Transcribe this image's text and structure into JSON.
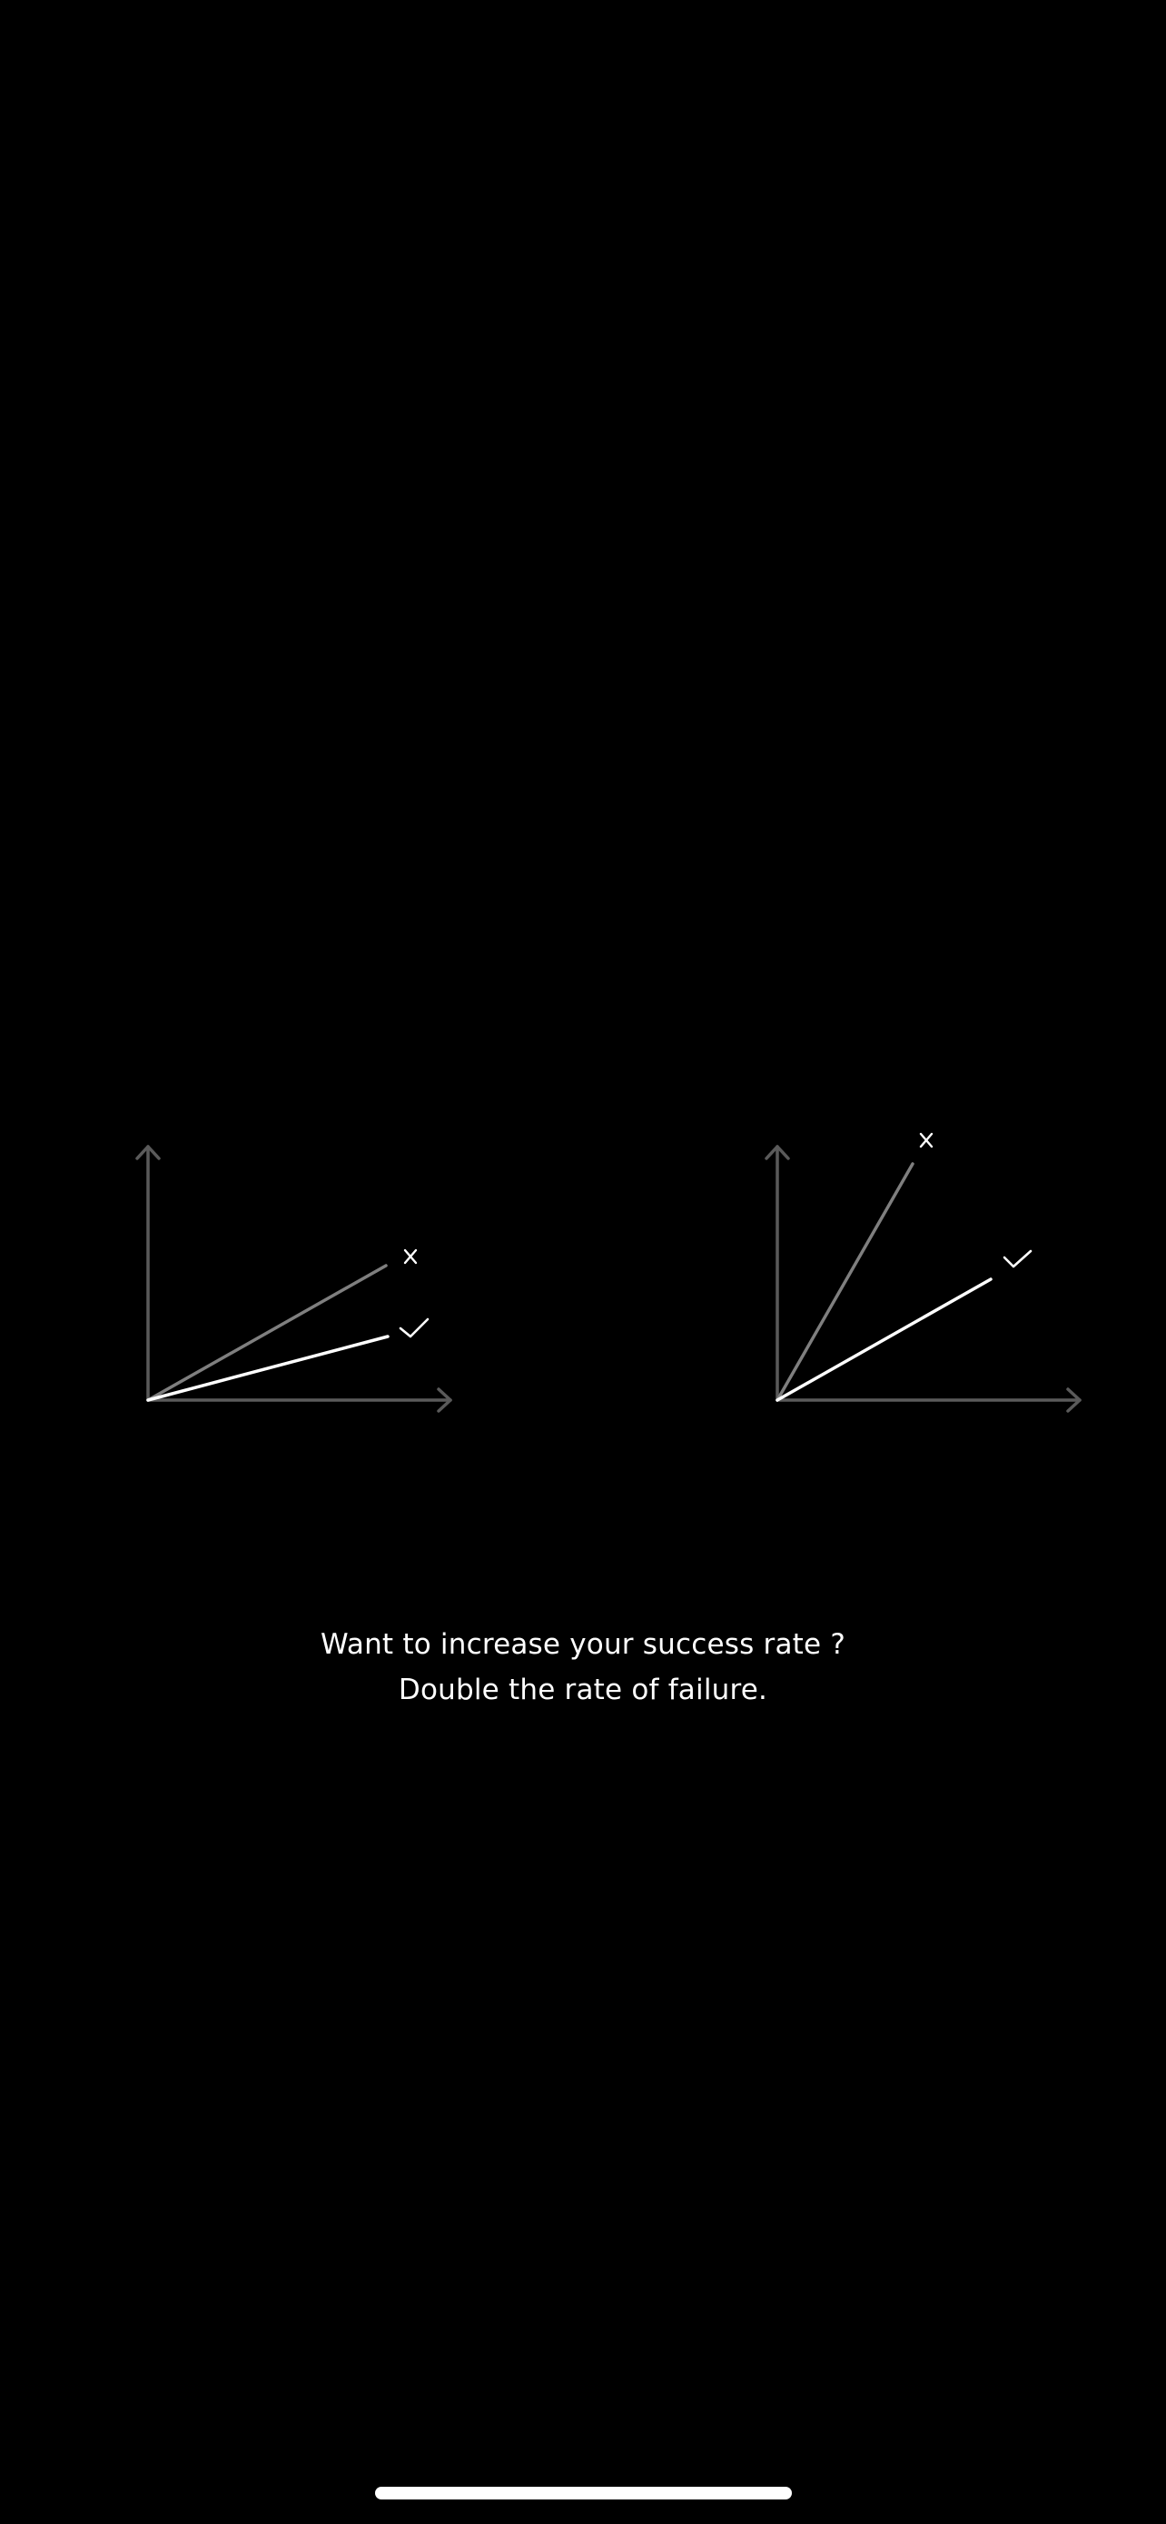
{
  "caption": {
    "line1": "Want to increase your success rate ?",
    "line2": "Double the rate of failure."
  },
  "diagrams": [
    {
      "name": "left",
      "lines": [
        {
          "kind": "failure",
          "marker": "x-icon",
          "slope": 0.56
        },
        {
          "kind": "success",
          "marker": "check-icon",
          "slope": 0.28
        }
      ]
    },
    {
      "name": "right",
      "lines": [
        {
          "kind": "failure",
          "marker": "x-icon",
          "slope": 1.75
        },
        {
          "kind": "success",
          "marker": "check-icon",
          "slope": 0.56
        }
      ]
    }
  ],
  "colors": {
    "background": "#000000",
    "axis": "#5a5a5a",
    "failure_line": "#7f7f7f",
    "success_line": "#ffffff",
    "text": "#ffffff"
  }
}
